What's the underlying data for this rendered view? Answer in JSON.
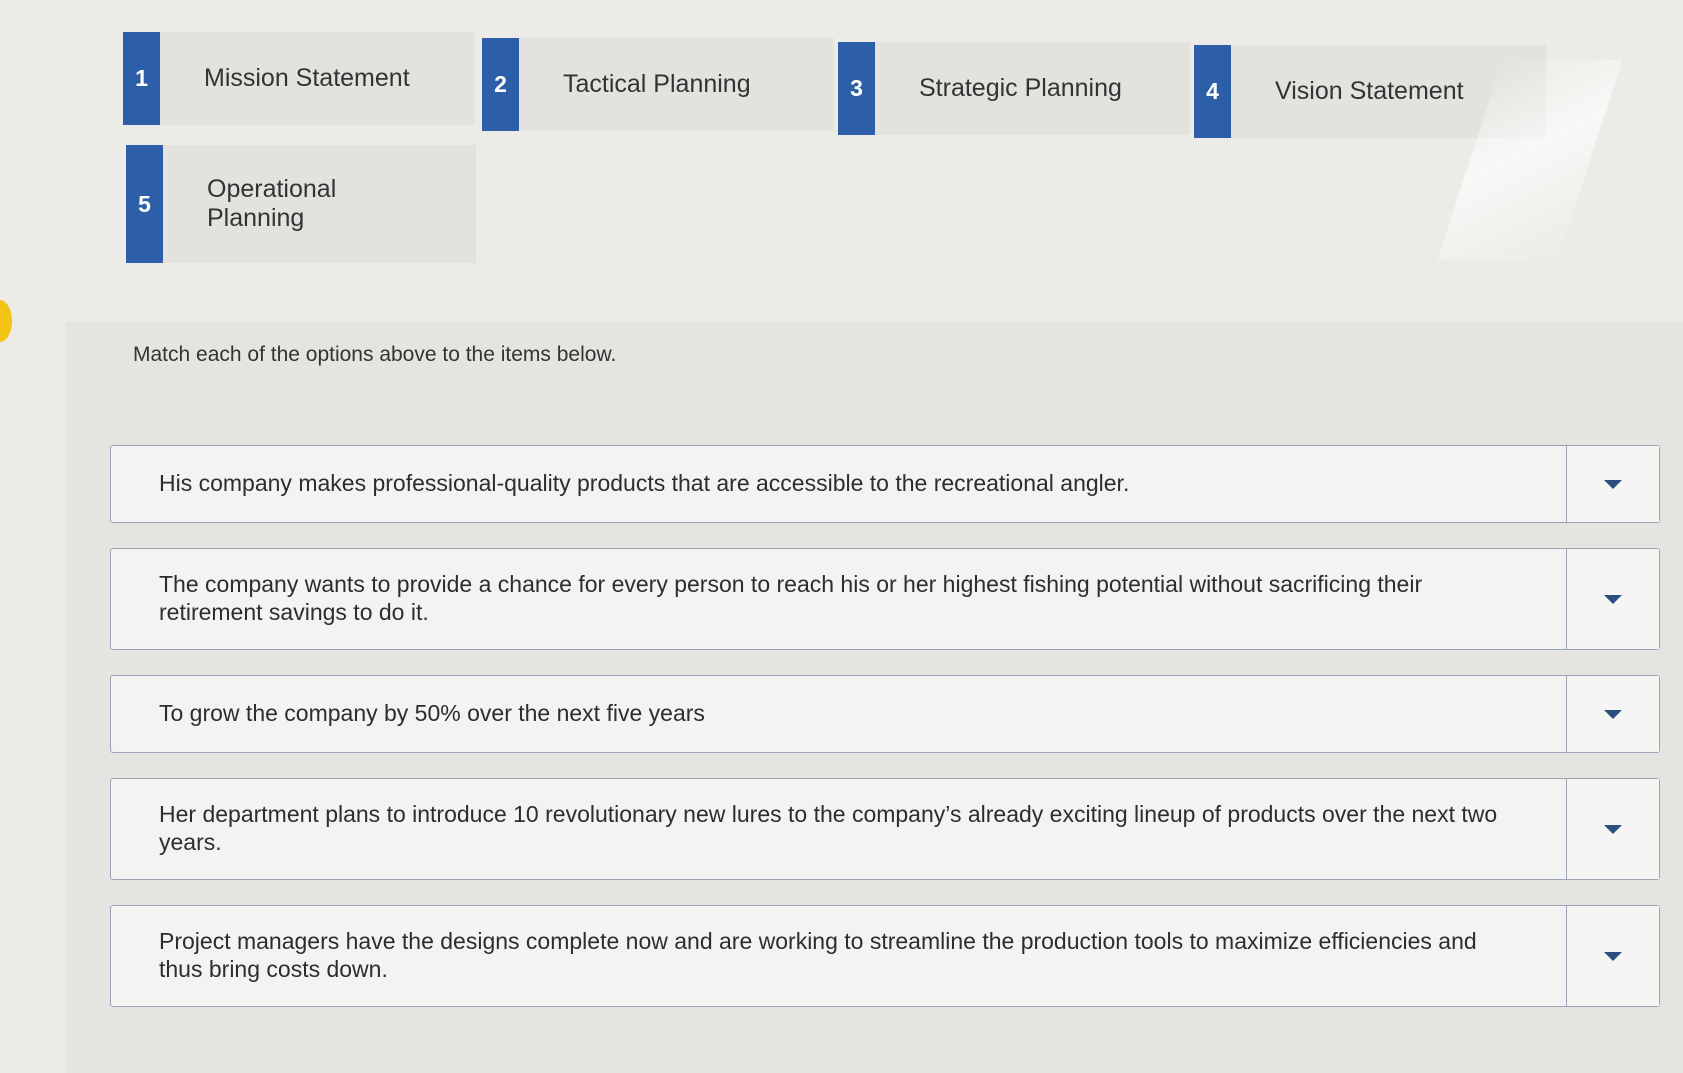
{
  "options": [
    {
      "number": "1",
      "label": "Mission Statement"
    },
    {
      "number": "2",
      "label": "Tactical Planning"
    },
    {
      "number": "3",
      "label": "Strategic Planning"
    },
    {
      "number": "4",
      "label": "Vision Statement"
    },
    {
      "number": "5",
      "label": "Operational Planning"
    }
  ],
  "instructions": "Match each of the options above to the items below.",
  "items": [
    {
      "text": "His company makes professional-quality products that are accessible to the recreational angler.",
      "selected": ""
    },
    {
      "text": "The company wants to provide a chance for every person to reach his or her highest fishing potential without sacrificing their retirement savings to do it.",
      "selected": ""
    },
    {
      "text": "To grow the company by 50% over the next five years",
      "selected": ""
    },
    {
      "text": "Her department plans to introduce 10 revolutionary new lures to the company’s already exciting lineup of products over the next two years.",
      "selected": ""
    },
    {
      "text": "Project managers have the designs complete now and are working to streamline the production tools to maximize efficiencies and thus bring costs down.",
      "selected": ""
    }
  ],
  "colors": {
    "badge": "#2c5fa8",
    "card": "#e3e2de",
    "background": "#ecebe7",
    "border": "#9aa4b4"
  }
}
